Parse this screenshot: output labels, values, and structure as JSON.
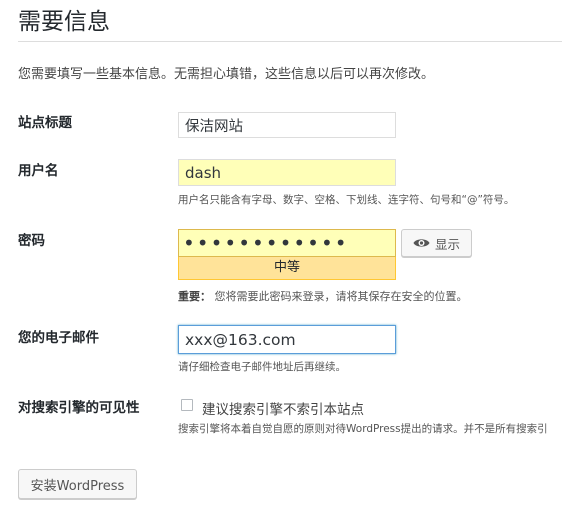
{
  "page": {
    "title": "需要信息",
    "intro": "您需要填写一些基本信息。无需担心填错，这些信息以后可以再次修改。"
  },
  "form": {
    "site_title": {
      "label": "站点标题",
      "value": "保洁网站"
    },
    "username": {
      "label": "用户名",
      "value": "dash",
      "description": "用户名只能含有字母、数字、空格、下划线、连字符、句号和“@”符号。"
    },
    "password": {
      "label": "密码",
      "value": "••••••••••••",
      "strength": "中等",
      "show_button": "显示",
      "important_prefix": "重要：",
      "important_text": "您将需要此密码来登录，请将其保存在安全的位置。"
    },
    "email": {
      "label": "您的电子邮件",
      "value": "xxx@163.com",
      "description": "请仔细检查电子邮件地址后再继续。"
    },
    "privacy": {
      "label": "对搜索引擎的可见性",
      "checkbox_label": "建议搜索引擎不索引本站点",
      "checked": false,
      "description": "搜索引擎将本着自觉自愿的原则对待WordPress提出的请求。并不是所有搜索引"
    },
    "submit_label": "安装WordPress"
  },
  "icons": {
    "show_password": "eye-icon"
  },
  "colors": {
    "input_highlight": "#ffffb8",
    "strength_medium_bg": "#ffe399",
    "strength_medium_border": "#ffc733",
    "focus_border": "#5b9dd9"
  }
}
